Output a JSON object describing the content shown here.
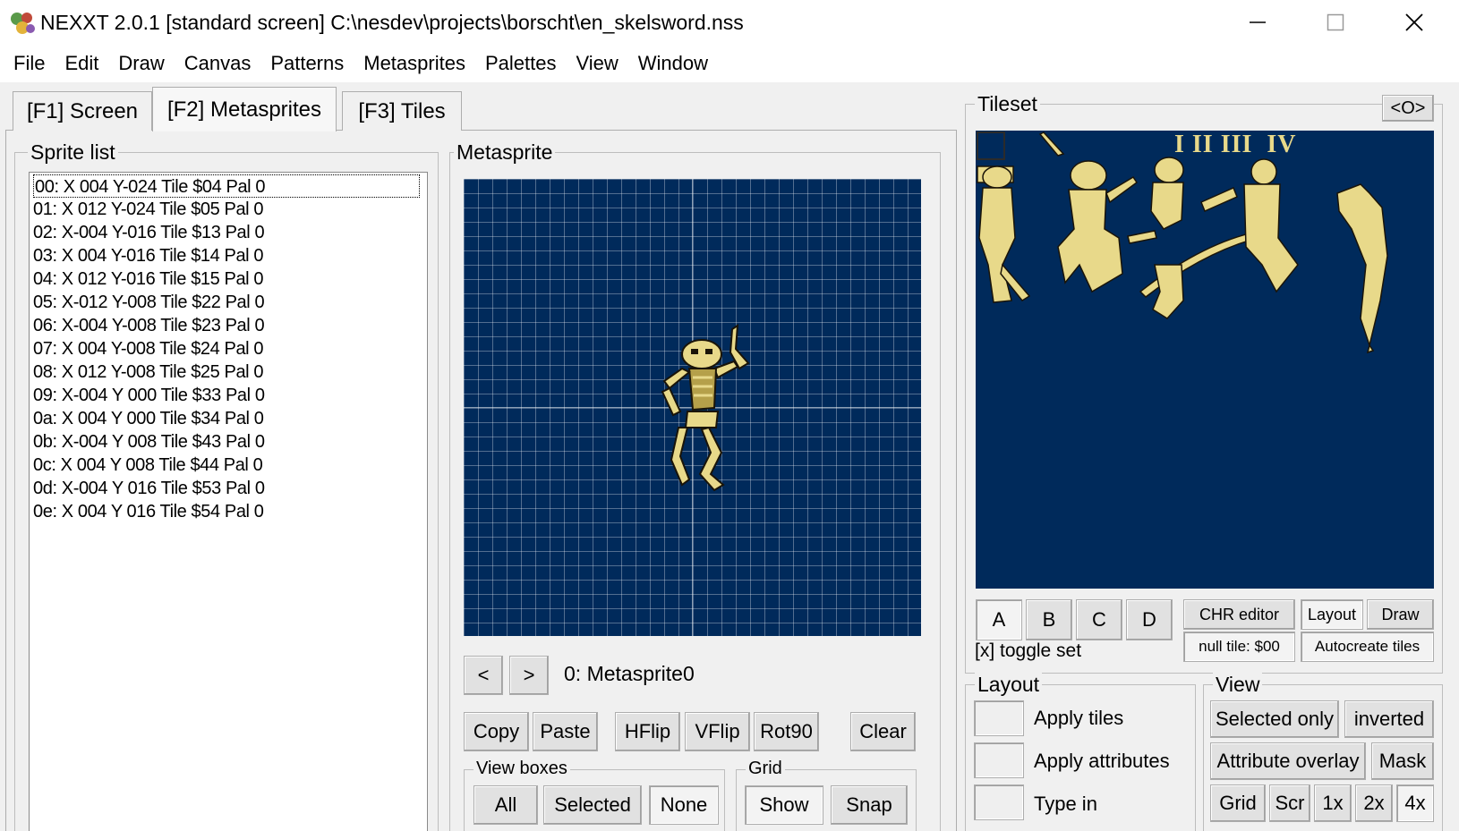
{
  "window": {
    "title": "NEXXT 2.0.1  [standard screen] C:\\nesdev\\projects\\borscht\\en_skelsword.nss",
    "controls": {
      "minimize": "—",
      "maximize": "☐",
      "close": "✕"
    }
  },
  "menu": [
    "File",
    "Edit",
    "Draw",
    "Canvas",
    "Patterns",
    "Metasprites",
    "Palettes",
    "View",
    "Window"
  ],
  "tabs": [
    {
      "label": "[F1] Screen",
      "active": false
    },
    {
      "label": "[F2] Metasprites",
      "active": true
    },
    {
      "label": "[F3] Tiles",
      "active": false
    }
  ],
  "sprite_list": {
    "title": "Sprite list",
    "items": [
      "00: X 004 Y-024 Tile $04 Pal 0",
      "01: X 012 Y-024 Tile $05 Pal 0",
      "02: X-004 Y-016 Tile $13 Pal 0",
      "03: X 004 Y-016 Tile $14 Pal 0",
      "04: X 012 Y-016 Tile $15 Pal 0",
      "05: X-012 Y-008 Tile $22 Pal 0",
      "06: X-004 Y-008 Tile $23 Pal 0",
      "07: X 004 Y-008 Tile $24 Pal 0",
      "08: X 012 Y-008 Tile $25 Pal 0",
      "09: X-004 Y 000 Tile $33 Pal 0",
      "0a: X 004 Y 000 Tile $34 Pal 0",
      "0b: X-004 Y 008 Tile $43 Pal 0",
      "0c: X 004 Y 008 Tile $44 Pal 0",
      "0d: X-004 Y 016 Tile $53 Pal 0",
      "0e: X 004 Y 016 Tile $54 Pal 0"
    ],
    "selected_index": 0
  },
  "metasprite": {
    "title": "Metasprite",
    "prev_label": "<",
    "next_label": ">",
    "current_name": "0: Metasprite0",
    "buttons": {
      "copy": "Copy",
      "paste": "Paste",
      "hflip": "HFlip",
      "vflip": "VFlip",
      "rot90": "Rot90",
      "clear": "Clear"
    },
    "view_boxes": {
      "title": "View boxes",
      "all": "All",
      "selected": "Selected",
      "none": "None",
      "active": "None"
    },
    "grid": {
      "title": "Grid",
      "show": "Show",
      "snap": "Snap",
      "active": "Show"
    }
  },
  "tileset": {
    "title": "Tileset",
    "toggle_button": "<O>",
    "roman_labels": "I II III  IV",
    "sets": [
      "A",
      "B",
      "C",
      "D"
    ],
    "active_set": "A",
    "toggle_hint": "[x] toggle set",
    "chr_editor": "CHR editor",
    "layout": "Layout",
    "draw": "Draw",
    "null_tile": "null tile: $00",
    "autocreate": "Autocreate tiles"
  },
  "layout_panel": {
    "title": "Layout",
    "apply_tiles": "Apply tiles",
    "apply_attributes": "Apply attributes",
    "type_in": "Type in"
  },
  "view_panel": {
    "title": "View",
    "selected_only": "Selected only",
    "inverted": "inverted",
    "attribute_overlay": "Attribute overlay",
    "mask": "Mask",
    "grid": "Grid",
    "scr": "Scr",
    "zoom_1x": "1x",
    "zoom_2x": "2x",
    "zoom_4x": "4x",
    "active_zoom": "4x"
  },
  "colors": {
    "canvas_bg": "#002a5b",
    "sprite_light": "#e8d98a",
    "sprite_mid": "#b5a04a",
    "sprite_dark": "#1a1408"
  }
}
